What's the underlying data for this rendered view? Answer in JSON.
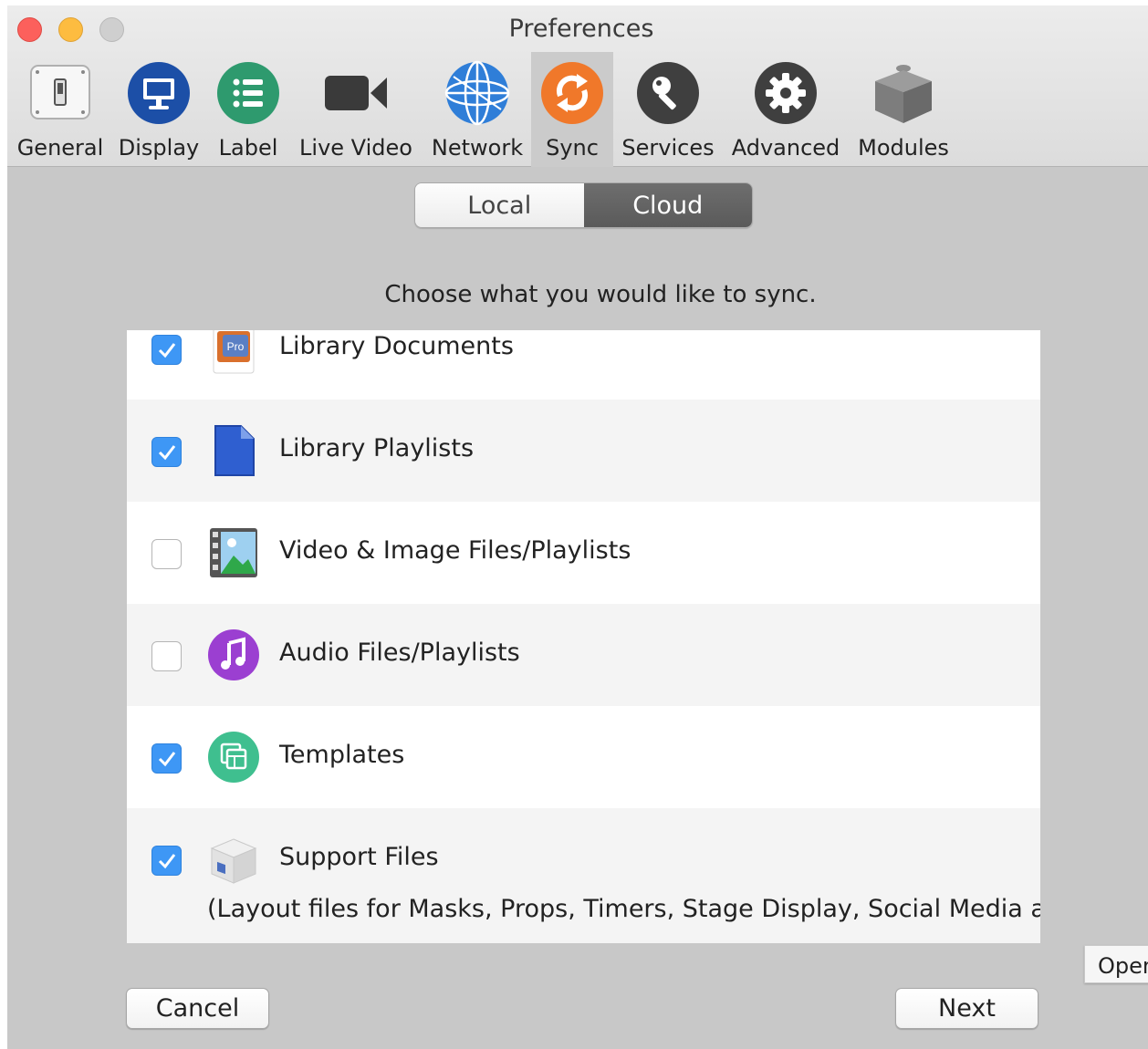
{
  "window": {
    "title": "Preferences"
  },
  "toolbar": {
    "items": [
      {
        "label": "General",
        "icon": "general-switch-icon"
      },
      {
        "label": "Display",
        "icon": "display-monitor-icon"
      },
      {
        "label": "Label",
        "icon": "label-list-icon"
      },
      {
        "label": "Live Video",
        "icon": "video-camera-icon"
      },
      {
        "label": "Network",
        "icon": "network-globe-icon"
      },
      {
        "label": "Sync",
        "icon": "sync-arrows-icon",
        "selected": true
      },
      {
        "label": "Services",
        "icon": "services-key-icon"
      },
      {
        "label": "Advanced",
        "icon": "advanced-gear-icon"
      },
      {
        "label": "Modules",
        "icon": "modules-cube-icon"
      }
    ]
  },
  "segment": {
    "local": "Local",
    "cloud": "Cloud",
    "selected": "Cloud"
  },
  "prompt": "Choose what you would like to sync.",
  "sync_items": [
    {
      "label": "Library Documents",
      "checked": true,
      "icon": "pro-document-icon"
    },
    {
      "label": "Library Playlists",
      "checked": true,
      "icon": "playlist-file-icon"
    },
    {
      "label": "Video & Image Files/Playlists",
      "checked": false,
      "icon": "media-film-icon"
    },
    {
      "label": "Audio Files/Playlists",
      "checked": false,
      "icon": "music-note-icon"
    },
    {
      "label": "Templates",
      "checked": true,
      "icon": "templates-icon"
    },
    {
      "label": "Support Files",
      "checked": true,
      "icon": "support-files-box-icon",
      "sublabel": "(Layout files for Masks, Props, Timers, Stage Display, Social Media and CCLI)"
    }
  ],
  "buttons": {
    "cancel": "Cancel",
    "next": "Next",
    "open": "Open"
  },
  "colors": {
    "checkbox_checked": "#3e97f5",
    "sync_accent": "#f0782a"
  }
}
